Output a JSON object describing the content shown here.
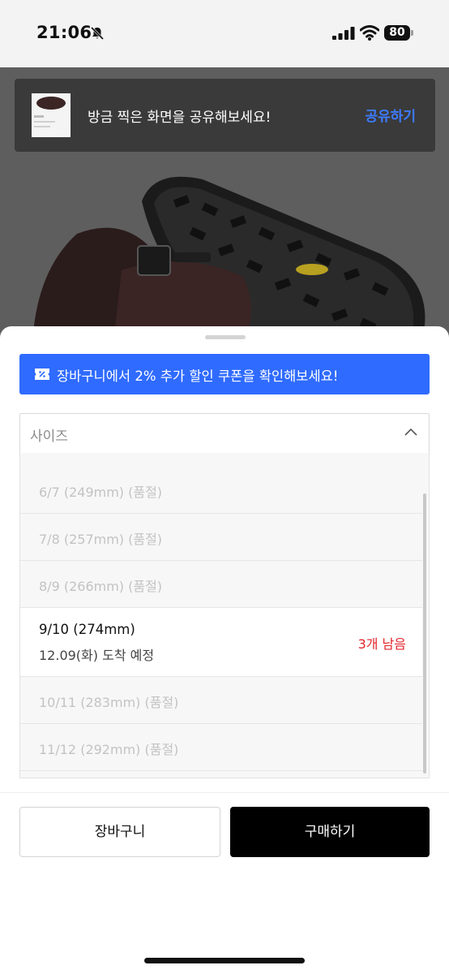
{
  "status_bar": {
    "time": "21:06",
    "battery_level": "80",
    "icons": [
      "mute-icon",
      "signal-icon",
      "wifi-icon",
      "battery-icon"
    ]
  },
  "share_toast": {
    "message": "방금 찍은 화면을 공유해보세요!",
    "action": "공유하기"
  },
  "coupon_banner": {
    "text": "장바구니에서 2% 추가 할인 쿠폰을 확인해보세요!",
    "icon": "coupon-icon"
  },
  "size_select": {
    "label": "사이즈",
    "options": [
      {
        "label": "6/7 (249mm) (품절)",
        "state": "sold-out"
      },
      {
        "label": "7/8 (257mm) (품절)",
        "state": "sold-out"
      },
      {
        "label": "8/9 (266mm) (품절)",
        "state": "sold-out"
      },
      {
        "label": "9/10 (274mm)",
        "delivery": "12.09(화) 도착 예정",
        "stock": "3개 남음",
        "state": "available"
      },
      {
        "label": "10/11 (283mm) (품절)",
        "state": "sold-out"
      },
      {
        "label": "11/12 (292mm) (품절)",
        "state": "sold-out"
      }
    ]
  },
  "actions": {
    "cart_label": "장바구니",
    "buy_label": "구매하기"
  },
  "colors": {
    "accent_blue": "#2f6bff",
    "share_blue": "#3d7bff",
    "stock_red": "#e0262b",
    "buy_black": "#000000"
  }
}
